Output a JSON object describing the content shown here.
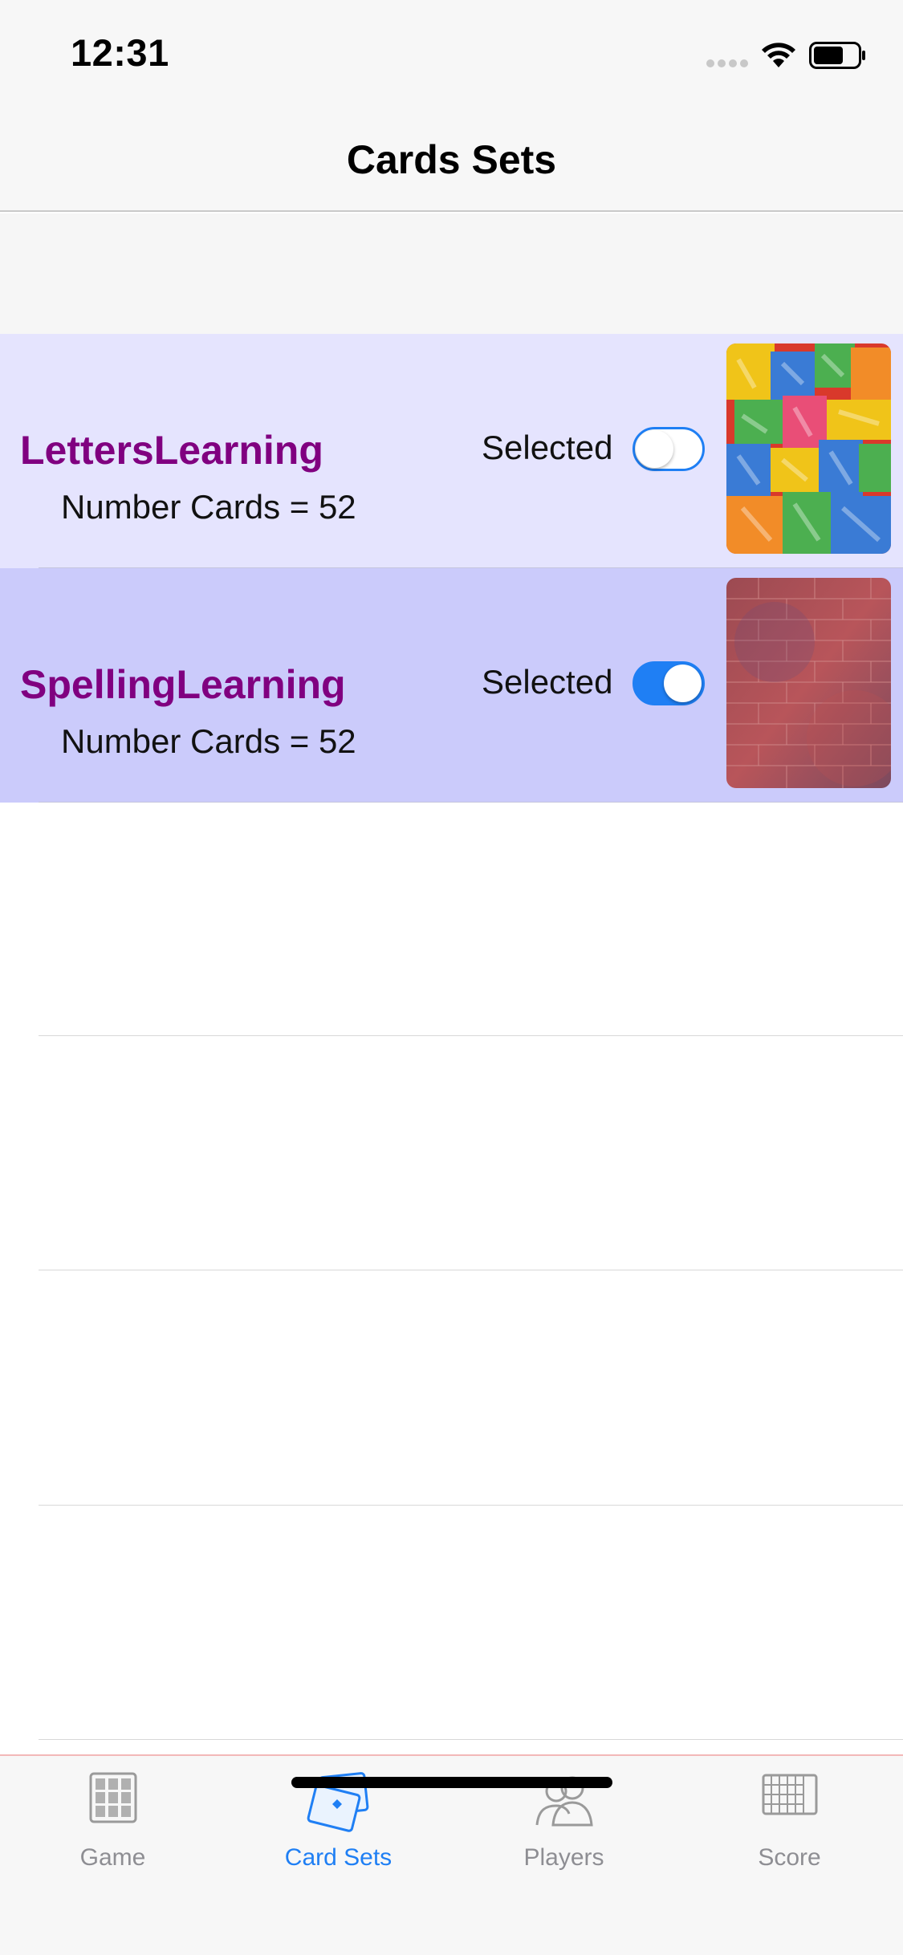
{
  "status_bar": {
    "time": "12:31"
  },
  "nav": {
    "title": "Cards Sets"
  },
  "card_sets": [
    {
      "title": "LettersLearning",
      "subtitle": "Number Cards = 52",
      "selected_label": "Selected",
      "selected": false,
      "thumbnail": "colorful-letters-image"
    },
    {
      "title": "SpellingLearning",
      "subtitle": "Number Cards = 52",
      "selected_label": "Selected",
      "selected": true,
      "thumbnail": "red-brick-wall-image"
    }
  ],
  "tab_bar": {
    "tabs": [
      {
        "label": "Game",
        "icon": "grid-icon",
        "active": false
      },
      {
        "label": "Card Sets",
        "icon": "cards-icon",
        "active": true
      },
      {
        "label": "Players",
        "icon": "people-icon",
        "active": false
      },
      {
        "label": "Score",
        "icon": "scoreboard-icon",
        "active": false
      }
    ]
  },
  "colors": {
    "accent": "#1f7ff4",
    "title_purple": "#800080",
    "cell_1_bg": "#e5e4fe",
    "cell_2_bg": "#cbcbfb",
    "tab_inactive": "#8e8e93"
  }
}
